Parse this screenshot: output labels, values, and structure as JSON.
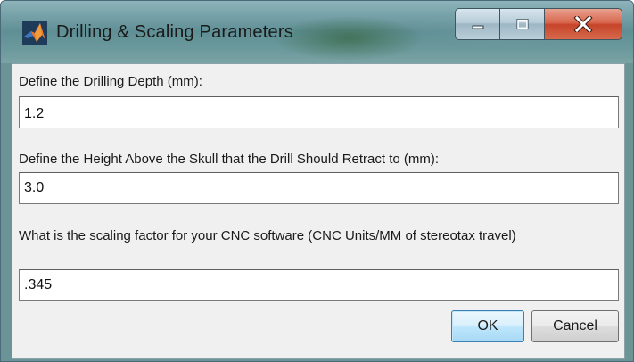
{
  "window": {
    "title": "Drilling & Scaling Parameters",
    "app_icon": "matlab-icon",
    "caption_buttons": [
      "minimize-icon",
      "maximize-icon",
      "close-icon"
    ]
  },
  "fields": [
    {
      "label": "Define the Drilling Depth (mm):",
      "value": "1.2"
    },
    {
      "label": "Define the Height Above the Skull that the Drill Should Retract to (mm):",
      "value": "3.0"
    },
    {
      "label": "What is the scaling factor for your CNC software (CNC Units/MM of stereotax travel)",
      "value": ".345"
    }
  ],
  "buttons": {
    "ok_label": "OK",
    "cancel_label": "Cancel"
  },
  "colors": {
    "ok_button_border": "#3c7fb1",
    "close_button": "#c6442a"
  }
}
